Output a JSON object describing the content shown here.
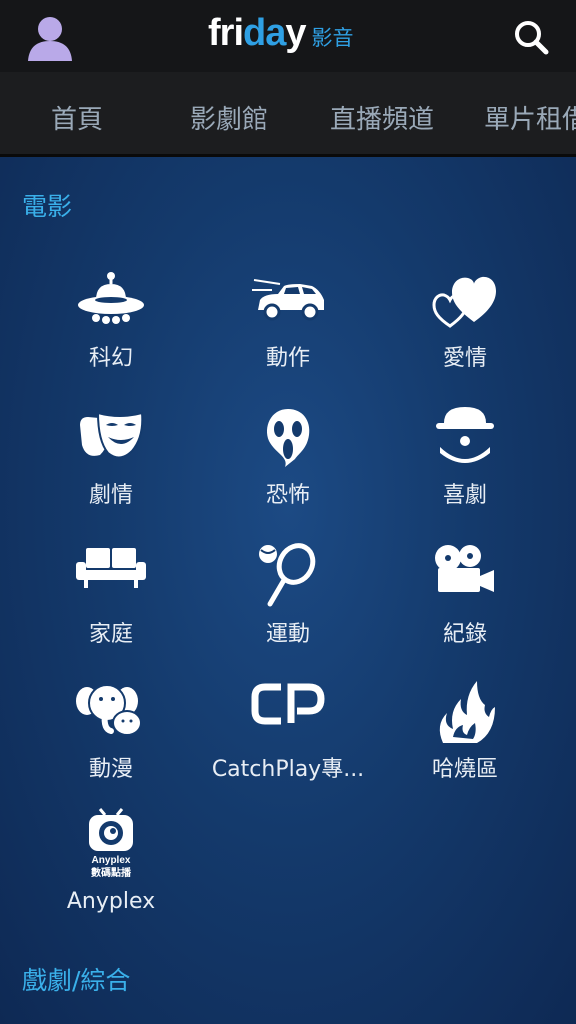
{
  "header": {
    "logo_main": "friday",
    "logo_sub": "影音"
  },
  "tabs": [
    "首頁",
    "影劇館",
    "直播頻道",
    "單片租借"
  ],
  "sections": {
    "movies": {
      "title": "電影",
      "items": [
        {
          "label": "科幻",
          "icon": "ufo-icon"
        },
        {
          "label": "動作",
          "icon": "car-icon"
        },
        {
          "label": "愛情",
          "icon": "hearts-icon"
        },
        {
          "label": "劇情",
          "icon": "theater-masks-icon"
        },
        {
          "label": "恐怖",
          "icon": "scream-mask-icon"
        },
        {
          "label": "喜劇",
          "icon": "clown-icon"
        },
        {
          "label": "家庭",
          "icon": "sofa-icon"
        },
        {
          "label": "運動",
          "icon": "tennis-icon"
        },
        {
          "label": "紀錄",
          "icon": "movie-camera-icon"
        },
        {
          "label": "動漫",
          "icon": "elephant-icon"
        },
        {
          "label": "CatchPlay專...",
          "icon": "catchplay-logo-icon"
        },
        {
          "label": "哈燒區",
          "icon": "flame-icon"
        },
        {
          "label": "Anyplex",
          "icon": "anyplex-logo-icon",
          "badge_line1": "Anyplex",
          "badge_line2": "數碼點播"
        }
      ]
    },
    "drama": {
      "title": "戲劇/綜合"
    }
  }
}
